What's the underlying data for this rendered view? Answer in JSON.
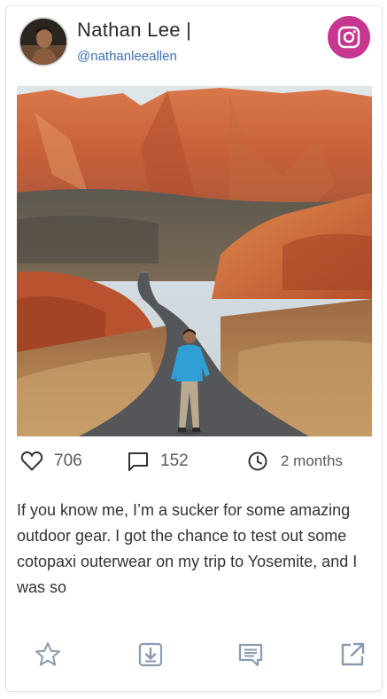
{
  "profile": {
    "name": "Nathan Lee |",
    "handle": "@nathanleeallen"
  },
  "platform": {
    "icon": "instagram-icon",
    "color": "#c7368f"
  },
  "post": {
    "image_alt": "Man walking on a winding road through red rock canyon",
    "likes": "706",
    "comments": "152",
    "time": "2 months",
    "caption": "If you know me, I’m a sucker for some amazing outdoor gear. I got the chance to test out some cotopaxi outerwear on my trip to Yosemite, and I was so"
  },
  "actions": [
    {
      "icon": "star-icon"
    },
    {
      "icon": "download-icon"
    },
    {
      "icon": "comment-icon"
    },
    {
      "icon": "external-link-icon"
    }
  ],
  "colors": {
    "handle": "#3d6fb4",
    "icon_gray": "#8a9bb0"
  }
}
